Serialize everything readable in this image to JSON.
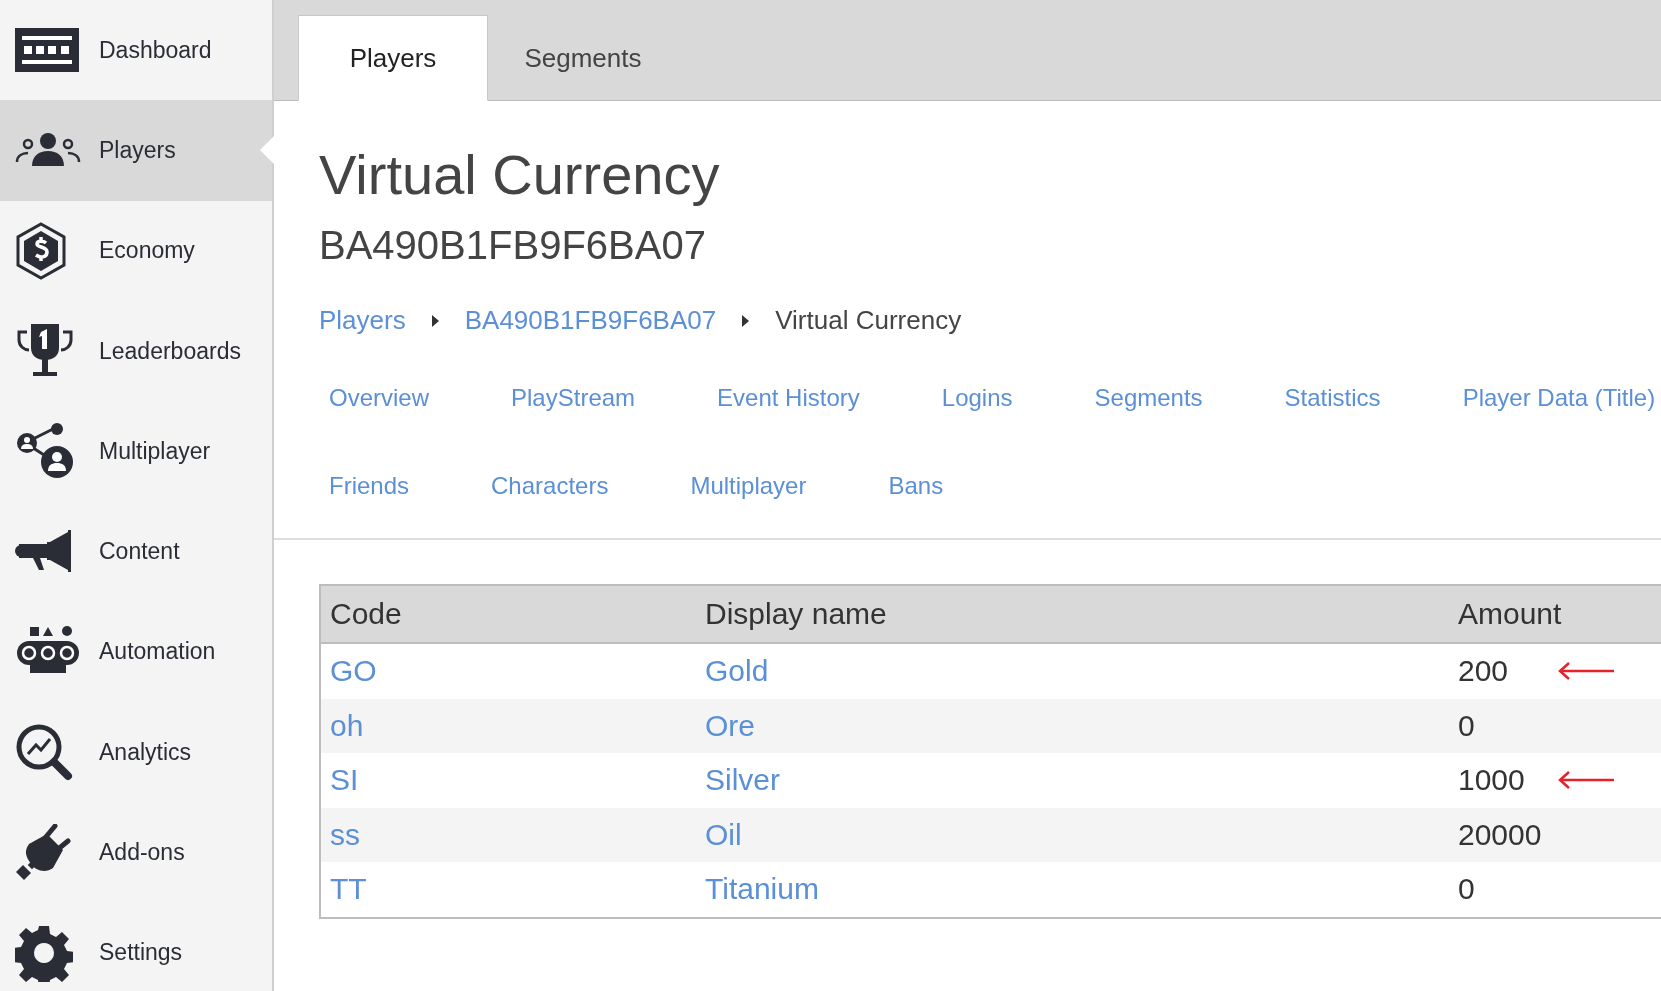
{
  "sidebar": {
    "items": [
      {
        "kind": "dashboard",
        "label": "Dashboard",
        "selected": false
      },
      {
        "kind": "players",
        "label": "Players",
        "selected": true
      },
      {
        "kind": "economy",
        "label": "Economy",
        "selected": false
      },
      {
        "kind": "leaderboards",
        "label": "Leaderboards",
        "selected": false
      },
      {
        "kind": "multiplayer",
        "label": "Multiplayer",
        "selected": false
      },
      {
        "kind": "content",
        "label": "Content",
        "selected": false
      },
      {
        "kind": "automation",
        "label": "Automation",
        "selected": false
      },
      {
        "kind": "analytics",
        "label": "Analytics",
        "selected": false
      },
      {
        "kind": "addons",
        "label": "Add-ons",
        "selected": false
      },
      {
        "kind": "settings",
        "label": "Settings",
        "selected": false
      }
    ]
  },
  "tabs": [
    {
      "label": "Players",
      "selected": true
    },
    {
      "label": "Segments",
      "selected": false
    }
  ],
  "page": {
    "title": "Virtual Currency",
    "subtitle": "BA490B1FB9F6BA07",
    "breadcrumb": [
      {
        "label": "Players",
        "link": true
      },
      {
        "label": "BA490B1FB9F6BA07",
        "link": true
      },
      {
        "label": "Virtual Currency",
        "link": false
      }
    ],
    "subnav": [
      [
        "Overview",
        "PlayStream",
        "Event History",
        "Logins",
        "Segments",
        "Statistics",
        "Player Data (Title)"
      ],
      [
        "Friends",
        "Characters",
        "Multiplayer",
        "Bans"
      ]
    ]
  },
  "table": {
    "columns": [
      "Code",
      "Display name",
      "Amount"
    ],
    "rows": [
      {
        "code": "GO",
        "display_name": "Gold",
        "amount": "200",
        "arrow": true
      },
      {
        "code": "oh",
        "display_name": "Ore",
        "amount": "0",
        "arrow": false
      },
      {
        "code": "SI",
        "display_name": "Silver",
        "amount": "1000",
        "arrow": true
      },
      {
        "code": "ss",
        "display_name": "Oil",
        "amount": "20000",
        "arrow": false
      },
      {
        "code": "TT",
        "display_name": "Titanium",
        "amount": "0",
        "arrow": false
      }
    ]
  }
}
